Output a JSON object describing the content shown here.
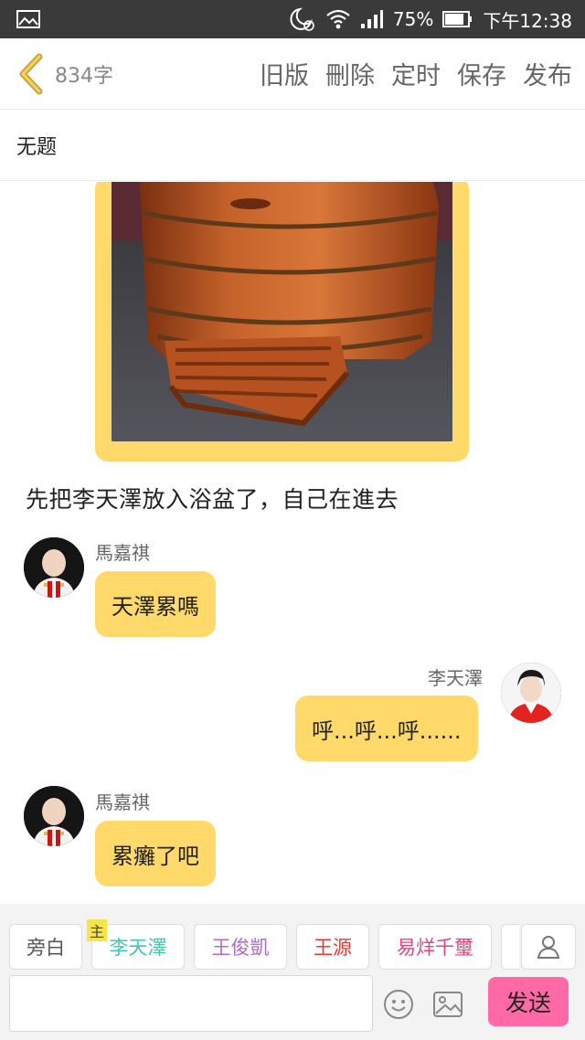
{
  "status_bar": {
    "battery": "75%",
    "time": "下午12:38"
  },
  "header": {
    "word_count": "834字",
    "actions": [
      "旧版",
      "刪除",
      "定时",
      "保存",
      "发布"
    ]
  },
  "title": "无题",
  "narration": "先把李天澤放入浴盆了，自己在進去",
  "messages": [
    {
      "name": "馬嘉祺",
      "text": "天澤累嗎"
    },
    {
      "name": "李天澤",
      "text": "呼...呼...呼......"
    },
    {
      "name": "馬嘉祺",
      "text": "累癱了吧"
    }
  ],
  "roles": {
    "narrator": "旁白",
    "host_tag": "主",
    "r1": "李天澤",
    "r2": "王俊凱",
    "r3": "王源",
    "r4": "易烊千璽"
  },
  "role_colors": {
    "r1": "#3ec9b3",
    "r2": "#b06ac9",
    "r3": "#e53935",
    "r4": "#e0457b"
  },
  "input": {
    "send_label": "发送"
  },
  "colors": {
    "bubble": "#ffd96a",
    "accent": "#ffd54f",
    "send": "#ff6aa6"
  }
}
